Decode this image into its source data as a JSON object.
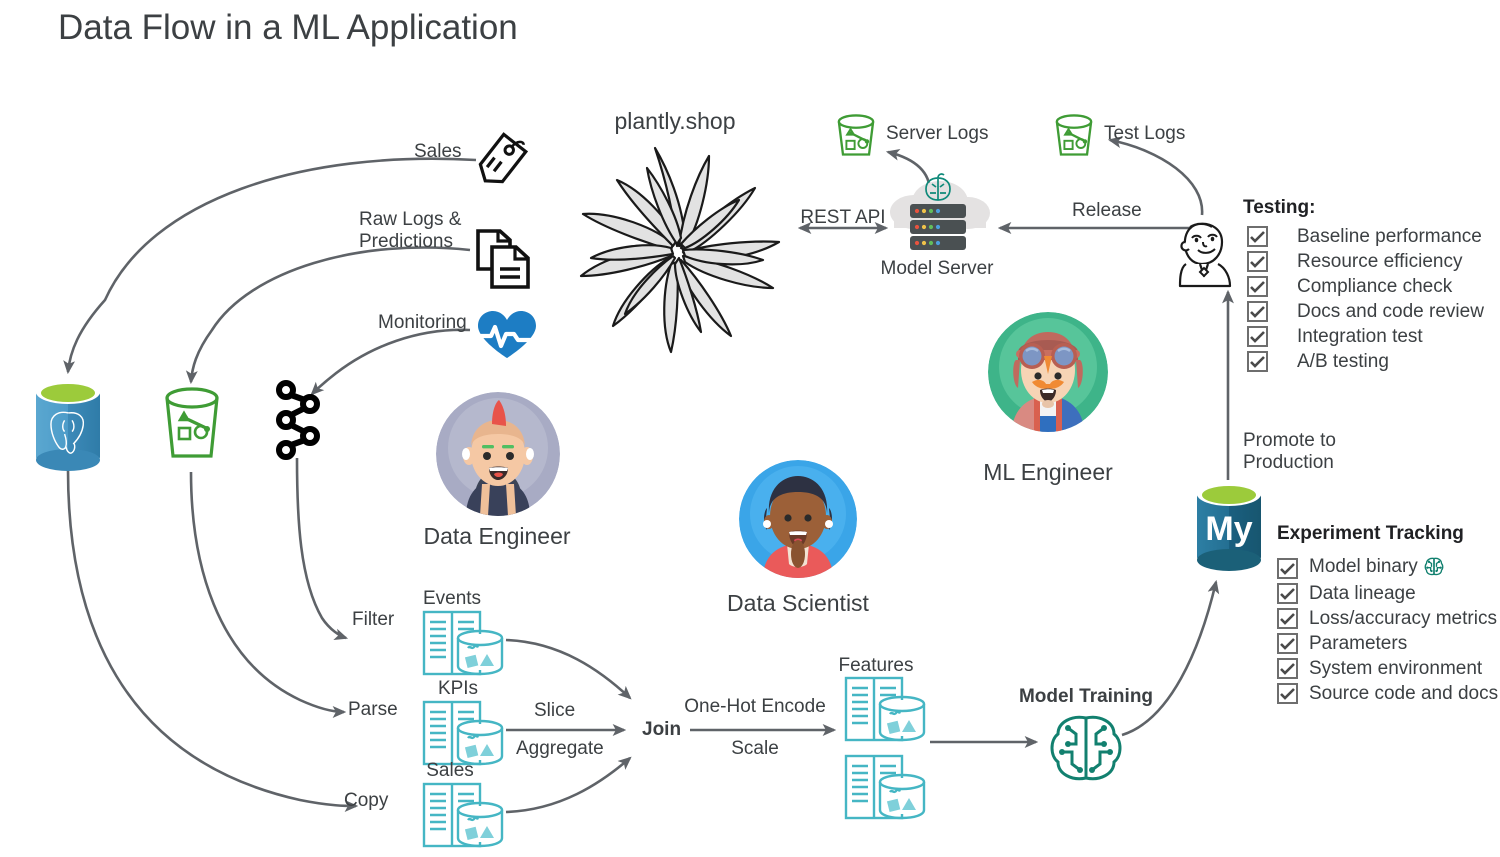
{
  "title": "Data Flow in a ML Application",
  "site": {
    "name": "plantly.shop",
    "logo_icon": "plant-leaves-logo"
  },
  "stores": {
    "postgres": {
      "icon": "postgresql-database-icon",
      "label": ""
    },
    "s3_raw": {
      "icon": "s3-bucket-icon",
      "label": ""
    },
    "kafka": {
      "icon": "kafka-icon",
      "label": ""
    },
    "server_logs": {
      "icon": "s3-bucket-icon",
      "label": "Server Logs"
    },
    "test_logs": {
      "icon": "s3-bucket-icon",
      "label": "Test Logs"
    },
    "mysql": {
      "icon": "mysql-database-icon",
      "label": ""
    }
  },
  "ingest_labels": [
    {
      "text": "Sales",
      "icon": "price-tag-icon"
    },
    {
      "text": "Raw Logs &\nPredictions",
      "icon": "documents-icon"
    },
    {
      "text": "Monitoring",
      "icon": "heartbeat-icon"
    }
  ],
  "serving": {
    "model_server_label": "Model Server",
    "model_server_icon": "server-rack-cloud-brain-icon",
    "rest_api_label": "REST API",
    "release_label": "Release"
  },
  "people": [
    {
      "label": "Data Engineer",
      "icon": "avatar-punk-icon"
    },
    {
      "label": "Data Scientist",
      "icon": "avatar-woman-icon"
    },
    {
      "label": "ML Engineer",
      "icon": "avatar-goggles-icon"
    },
    {
      "label": "",
      "icon": "jenkins-butler-icon"
    }
  ],
  "pipeline": {
    "edge_labels": [
      "Filter",
      "Parse",
      "Copy"
    ],
    "datasets": [
      {
        "label": "Events",
        "icon": "dataset-table-icon"
      },
      {
        "label": "KPIs",
        "icon": "dataset-table-icon"
      },
      {
        "label": "Sales",
        "icon": "dataset-table-icon"
      }
    ],
    "transform_labels": [
      "Slice",
      "Aggregate"
    ],
    "join_label": "Join",
    "encode_labels": [
      "One-Hot Encode",
      "Scale"
    ],
    "features_label": "Features",
    "features_icon": "dataset-table-icon",
    "model_training_label": "Model Training",
    "model_training_icon": "brain-circuit-icon",
    "promote_label": "Promote to\nProduction"
  },
  "testing": {
    "heading": "Testing:",
    "items": [
      "Baseline performance",
      "Resource efficiency",
      "Compliance check",
      "Docs and code review",
      "Integration test",
      "A/B testing"
    ]
  },
  "experiment_tracking": {
    "heading": "Experiment Tracking",
    "items": [
      "Model binary",
      "Data lineage",
      "Loss/accuracy metrics",
      "Parameters",
      "System environment",
      "Source code and docs"
    ],
    "model_binary_icon": "brain-circuit-icon"
  },
  "colors": {
    "text": "#3c4043",
    "arrow": "#5f6368",
    "teal": "#45b6c4",
    "dark_teal": "#10705e",
    "green": "#3f9c35",
    "postgres_blue": "#3d7fa6",
    "mysql_blue": "#1b6d8f",
    "lime": "#9ccb3b",
    "plant_fill": "#e0e0e0",
    "checkbox_border": "#6e6e6e"
  }
}
